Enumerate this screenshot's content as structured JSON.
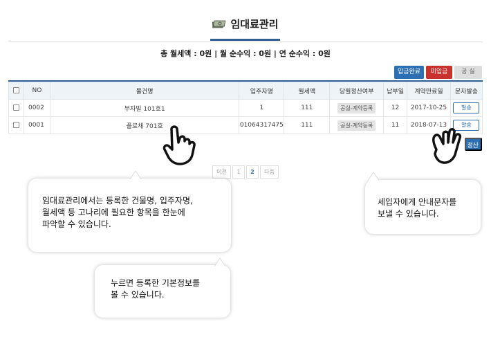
{
  "header": {
    "title": "임대료관리",
    "title_icon": "money-icon",
    "summary": "총 월세액 : 0원 | 월 순수익 : 0원 | 연 순수익 : 0원"
  },
  "toolbar": {
    "paid_label": "입금완료",
    "unpaid_label": "미입금",
    "vacant_label": "공 실"
  },
  "table": {
    "headers": [
      "NO",
      "물건명",
      "입주자명",
      "월세액",
      "당월정산여부",
      "납부일",
      "계약만료일",
      "문자발송"
    ],
    "rows": [
      {
        "no": "0002",
        "property": "부자빌 101호1",
        "tenant": "1",
        "rent": "111",
        "status": "공실-계약등록",
        "pay_day": "12",
        "expiry": "2017-10-25",
        "sms": "발송"
      },
      {
        "no": "0001",
        "property": "플로채 701호",
        "tenant": "01064317475",
        "rent": "111",
        "status": "공실-계약등록",
        "pay_day": "11",
        "expiry": "2018-07-13",
        "sms": "발송"
      }
    ]
  },
  "settle_label": "정산",
  "pagination": {
    "prev": "이전",
    "pages": [
      "1",
      "2"
    ],
    "current": "2",
    "next": "다음"
  },
  "callouts": {
    "c1": [
      "임대료관리에서는 등록한 건물명, 입주자명,",
      "월세액 등 고나리에 필요한 항목을 한눈에",
      "파악할 수 있습니다."
    ],
    "c2": [
      "누르면 등록한 기본정보를",
      "볼 수 있습니다."
    ],
    "c3": [
      "세입자에게 안내문자를",
      "보낼 수 있습니다."
    ]
  },
  "colors": {
    "accent": "#2c6fb3",
    "danger": "#c8322d",
    "header_bg": "#eef3f8"
  }
}
